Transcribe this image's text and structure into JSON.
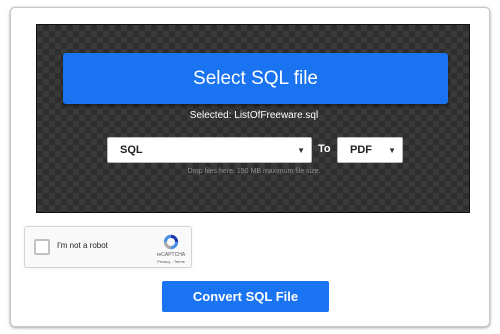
{
  "upload": {
    "select_button_label": "Select SQL file",
    "selected_text": "Selected: ListOfFreeware.sql",
    "drop_hint": "Drop files here. 150 MB maximum file size."
  },
  "conversion": {
    "from_format": "SQL",
    "to_label": "To",
    "to_format": "PDF"
  },
  "recaptcha": {
    "label": "I'm not a robot",
    "brand": "reCAPTCHA",
    "links": "Privacy - Terms"
  },
  "actions": {
    "convert_button_label": "Convert SQL File"
  },
  "colors": {
    "accent": "#1a73f0",
    "drop_zone_background": "#3a3a3a"
  }
}
